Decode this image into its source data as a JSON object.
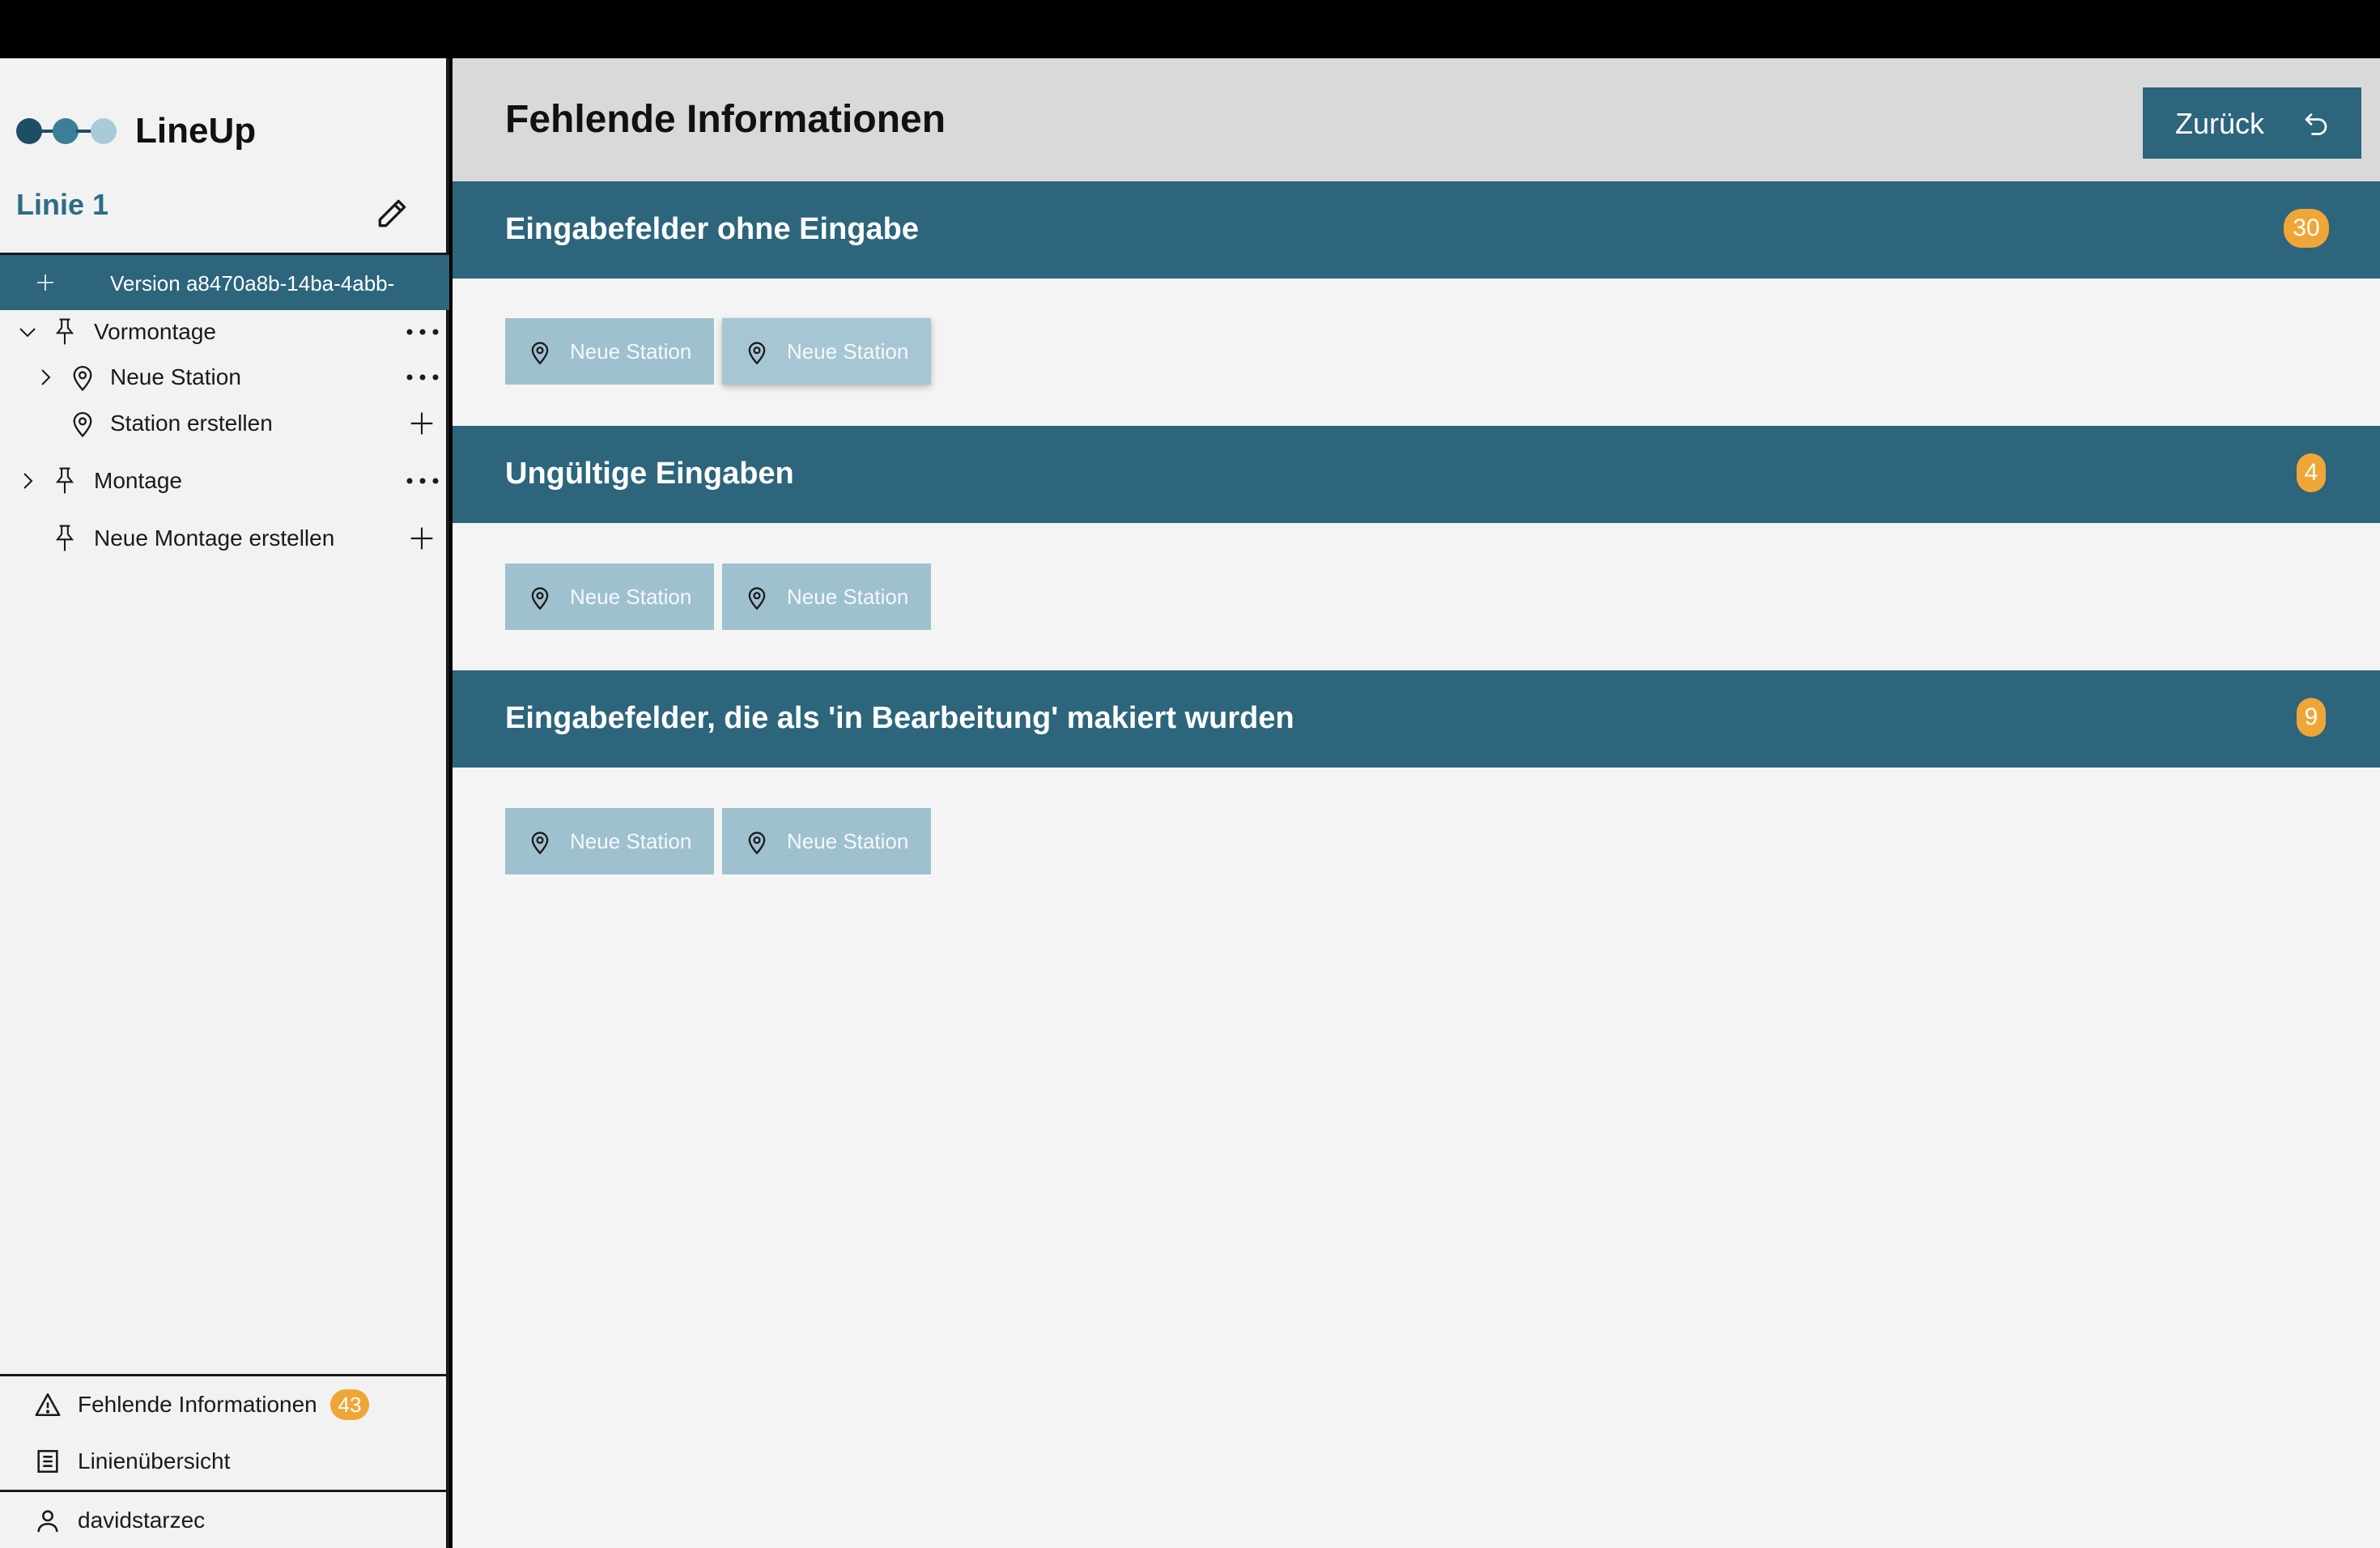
{
  "app": {
    "name": "LineUp",
    "line_title": "Linie 1",
    "version_label": "Version a8470a8b-14ba-4abb-"
  },
  "tree": [
    {
      "label": "Vormontage",
      "icon": "pushpin-icon",
      "expanded": true
    },
    {
      "label": "Neue Station",
      "icon": "location-pin-icon",
      "expanded": false
    },
    {
      "label": "Station erstellen",
      "icon": "location-pin-icon"
    },
    {
      "label": "Montage",
      "icon": "pushpin-icon",
      "expanded": false
    },
    {
      "label": "Neue Montage erstellen",
      "icon": "pushpin-icon"
    }
  ],
  "sidebar_bottom": {
    "missing_info_label": "Fehlende Informationen",
    "missing_info_count": "43",
    "overview_label": "Linienübersicht",
    "user_name": "davidstarzec"
  },
  "main": {
    "title": "Fehlende Informationen",
    "back_label": "Zurück",
    "sections": [
      {
        "title": "Eingabefelder ohne Eingabe",
        "count": "30",
        "stations": [
          "Neue Station",
          "Neue Station"
        ]
      },
      {
        "title": "Ungültige Eingaben",
        "count": "4",
        "stations": [
          "Neue Station",
          "Neue Station"
        ]
      },
      {
        "title": "Eingabefelder, die als 'in Bearbeitung' makiert wurden",
        "count": "9",
        "stations": [
          "Neue Station",
          "Neue Station"
        ]
      }
    ]
  },
  "colors": {
    "primary": "#2c657c",
    "accent_badge": "#f0a637",
    "station_button": "#9ec0cf",
    "header_bg": "#d9d9d9"
  }
}
